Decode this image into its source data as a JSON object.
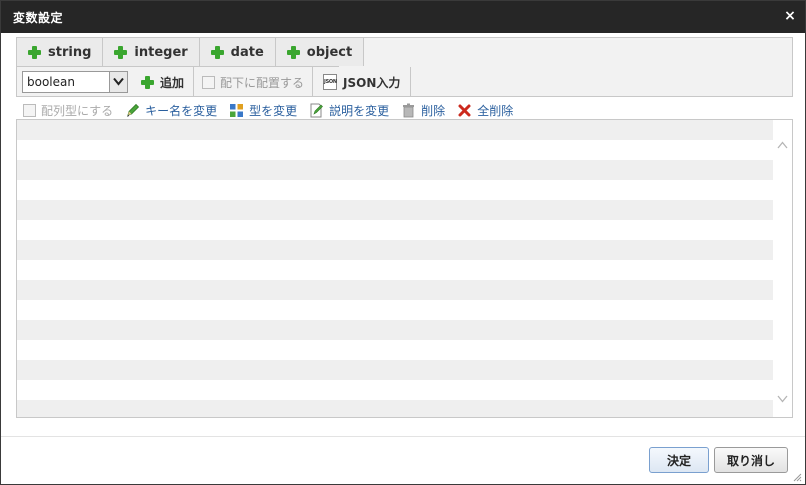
{
  "dialog": {
    "title": "変数設定",
    "close_glyph": "×"
  },
  "tabs": [
    {
      "label": "string"
    },
    {
      "label": "integer"
    },
    {
      "label": "date"
    },
    {
      "label": "object"
    }
  ],
  "toolbar": {
    "type_select_value": "boolean",
    "add_label": "追加",
    "place_under_label": "配下に配置する",
    "json_input_label": "JSON入力",
    "json_icon_text": "JSON"
  },
  "actions": {
    "array_label": "配列型にする",
    "rename_key_label": "キー名を変更",
    "change_type_label": "型を変更",
    "change_desc_label": "説明を変更",
    "delete_label": "削除",
    "delete_all_label": "全削除"
  },
  "footer": {
    "ok_label": "決定",
    "cancel_label": "取り消し"
  },
  "colors": {
    "titlebar": "#262626",
    "plus_green": "#3aa62f",
    "link_blue": "#2a5f9e",
    "stripe": "#efefef",
    "delete_red": "#cc2a1e"
  }
}
